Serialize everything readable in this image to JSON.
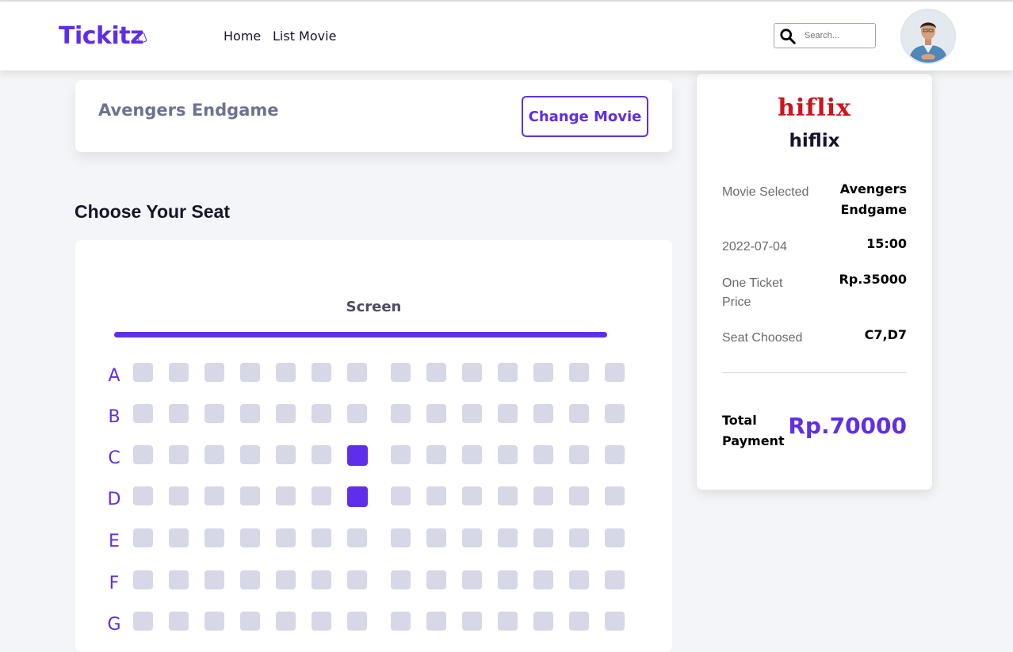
{
  "navbar": {
    "logo": "Tickitz",
    "links": [
      "Home",
      "List Movie"
    ],
    "search_placeholder": "Search..."
  },
  "movie": {
    "title": "Avengers Endgame",
    "change_button": "Change Movie"
  },
  "seat_section": {
    "title": "Choose Your Seat",
    "screen_label": "Screen",
    "rows": [
      "A",
      "B",
      "C",
      "D",
      "E",
      "F",
      "G"
    ],
    "seats_per_row": 14,
    "selected": [
      "C7",
      "D7"
    ]
  },
  "order": {
    "cinema_logo": "hiflix",
    "cinema_name": "hiflix",
    "movie_label": "Movie Selected",
    "movie_value": "Avengers Endgame",
    "date": "2022-07-04",
    "time": "15:00",
    "price_label": "One Ticket Price",
    "price_value": "Rp.35000",
    "seat_label": "Seat Choosed",
    "seat_value": "C7,D7",
    "total_label": "Total Payment",
    "total_value": "Rp.70000"
  },
  "colors": {
    "accent": "#5f2eea",
    "seat_available": "#d6d8e7",
    "cinema_logo": "#d0121b"
  },
  "icons": {
    "search": "search-icon",
    "avatar": "avatar",
    "logo": "ticket-icon"
  }
}
